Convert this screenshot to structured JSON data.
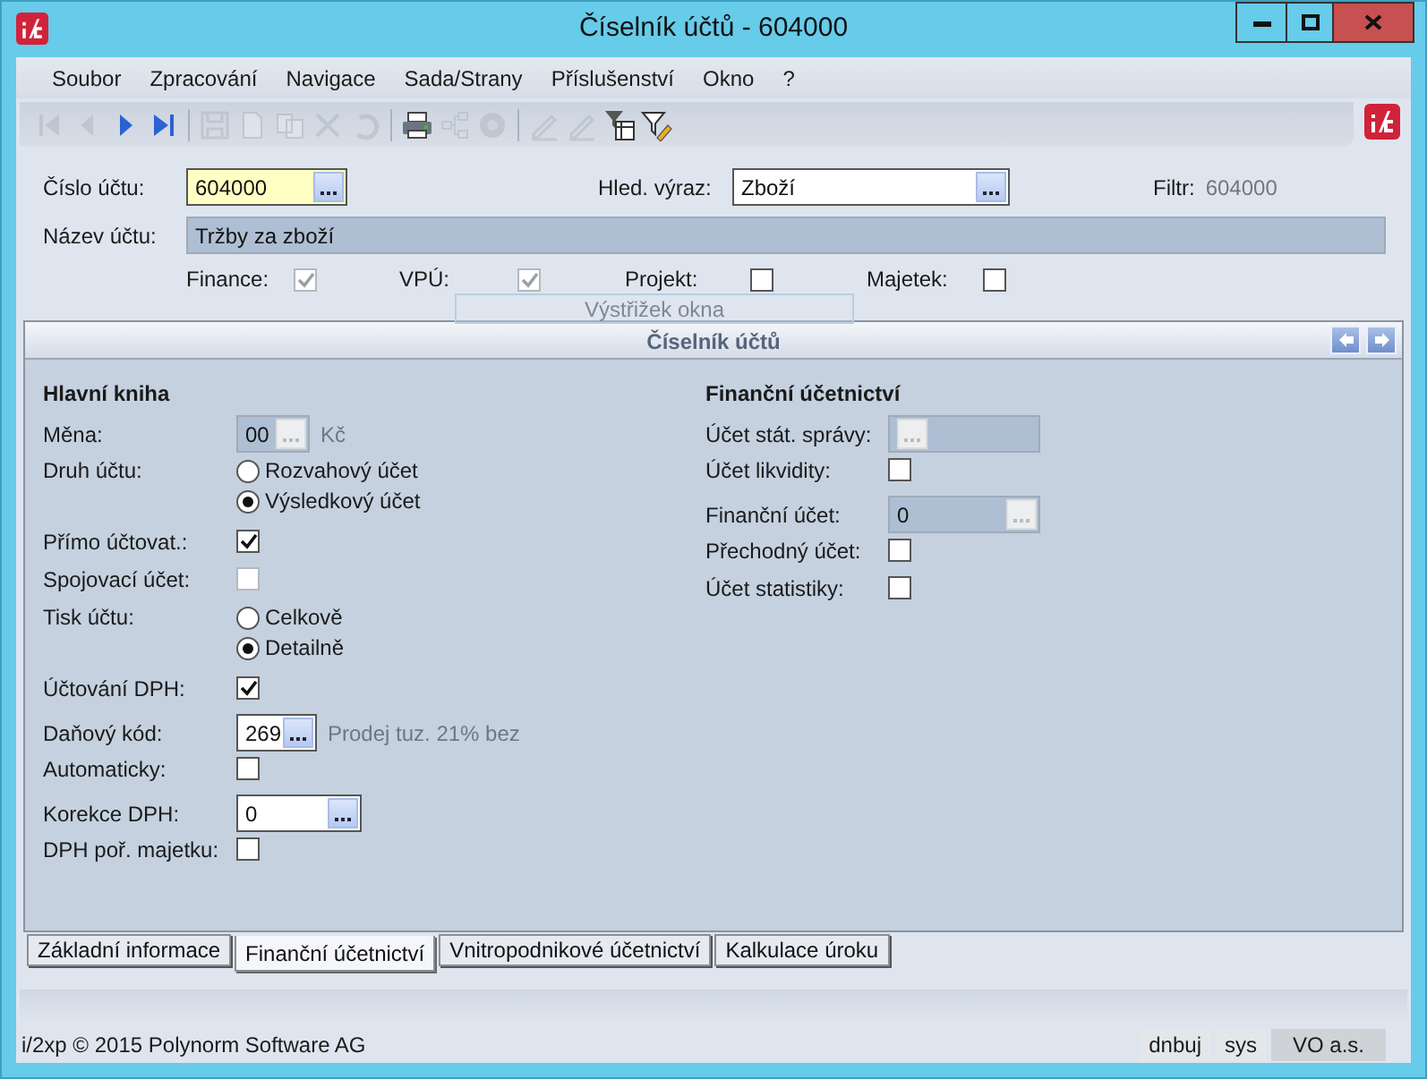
{
  "window": {
    "title": "Číselník účtů - 604000"
  },
  "menu": [
    "Soubor",
    "Zpracování",
    "Navigace",
    "Sada/Strany",
    "Příslušenství",
    "Okno",
    "?"
  ],
  "toolbar": [
    {
      "kind": "first",
      "disabled": true
    },
    {
      "kind": "prev",
      "disabled": true
    },
    {
      "kind": "next",
      "disabled": false
    },
    {
      "kind": "last",
      "disabled": false
    },
    {
      "kind": "sep"
    },
    {
      "kind": "save",
      "disabled": true
    },
    {
      "kind": "new",
      "disabled": true
    },
    {
      "kind": "copy",
      "disabled": true
    },
    {
      "kind": "delete",
      "disabled": true
    },
    {
      "kind": "undo",
      "disabled": true
    },
    {
      "kind": "sep"
    },
    {
      "kind": "print",
      "disabled": false
    },
    {
      "kind": "tree",
      "disabled": true
    },
    {
      "kind": "gear",
      "disabled": true
    },
    {
      "kind": "sep"
    },
    {
      "kind": "pencil",
      "disabled": true
    },
    {
      "kind": "pencil",
      "disabled": true
    },
    {
      "kind": "filter-table",
      "disabled": false
    },
    {
      "kind": "filter-edit",
      "disabled": false
    }
  ],
  "header": {
    "account": {
      "label": "Číslo účtu:",
      "value": "604000"
    },
    "search": {
      "label": "Hled. výraz:",
      "value": "Zboží"
    },
    "filter": {
      "label": "Filtr:",
      "value": "604000"
    },
    "name": {
      "label": "Název účtu:",
      "value": "Tržby za zboží"
    },
    "flags": [
      {
        "label": "Finance:",
        "checked": true,
        "disabled": true
      },
      {
        "label": "VPÚ:",
        "checked": true,
        "disabled": true
      },
      {
        "label": "Projekt:",
        "checked": false,
        "disabled": false
      },
      {
        "label": "Majetek:",
        "checked": false,
        "disabled": false
      }
    ]
  },
  "snip_hint": "Výstřižek okna",
  "panel": {
    "title": "Číselník účtů",
    "sections": [
      {
        "title": "Hlavní kniha",
        "rows": [
          {
            "kind": "lookup",
            "label": "Měna:",
            "value": "00",
            "disabled": true,
            "note": "Kč"
          },
          {
            "kind": "radio",
            "label": "Druh účtu:",
            "options": [
              {
                "label": "Rozvahový účet",
                "selected": false
              },
              {
                "label": "Výsledkový účet",
                "selected": true
              }
            ]
          },
          {
            "kind": "checkbox",
            "label": "Přímo účtovat.:",
            "checked": true,
            "disabled": false
          },
          {
            "kind": "checkbox",
            "label": "Spojovací účet:",
            "checked": false,
            "disabled": true
          },
          {
            "kind": "radio",
            "label": "Tisk účtu:",
            "options": [
              {
                "label": "Celkově",
                "selected": false
              },
              {
                "label": "Detailně",
                "selected": true
              }
            ]
          },
          {
            "kind": "checkbox",
            "label": "Účtování DPH:",
            "checked": true,
            "disabled": false
          },
          {
            "kind": "lookup",
            "label": "Daňový kód:",
            "value": "269",
            "disabled": false,
            "note": "Prodej tuz. 21% bez"
          },
          {
            "kind": "checkbox",
            "label": "Automaticky:",
            "checked": false,
            "disabled": false
          },
          {
            "kind": "lookup",
            "label": "Korekce DPH:",
            "value": "0",
            "disabled": false
          },
          {
            "kind": "checkbox",
            "label": "DPH poř. majetku:",
            "checked": false,
            "disabled": false
          }
        ]
      },
      {
        "title": "Finanční účetnictví",
        "rows": [
          {
            "kind": "lookup",
            "label": "Účet stát. správy:",
            "disabled": true
          },
          {
            "kind": "checkbox",
            "label": "Účet likvidity:",
            "checked": false,
            "disabled": false
          },
          {
            "kind": "lookup",
            "label": "Finanční účet:",
            "value": "0",
            "disabled": true
          },
          {
            "kind": "checkbox",
            "label": "Přechodný účet:",
            "checked": false,
            "disabled": false
          },
          {
            "kind": "checkbox",
            "label": "Účet statistiky:",
            "checked": false,
            "disabled": false
          }
        ]
      }
    ]
  },
  "tabs": [
    {
      "label": "Základní informace",
      "selected": false
    },
    {
      "label": "Finanční účetnictví",
      "selected": true
    },
    {
      "label": "Vnitropodnikové účetnictví",
      "selected": false
    },
    {
      "label": "Kalkulace úroku",
      "selected": false
    }
  ],
  "status_bar": {
    "text": "i/2xp © 2015 Polynorm Software AG",
    "cells": [
      "dnbuj",
      "sys",
      "VO a.s."
    ]
  }
}
